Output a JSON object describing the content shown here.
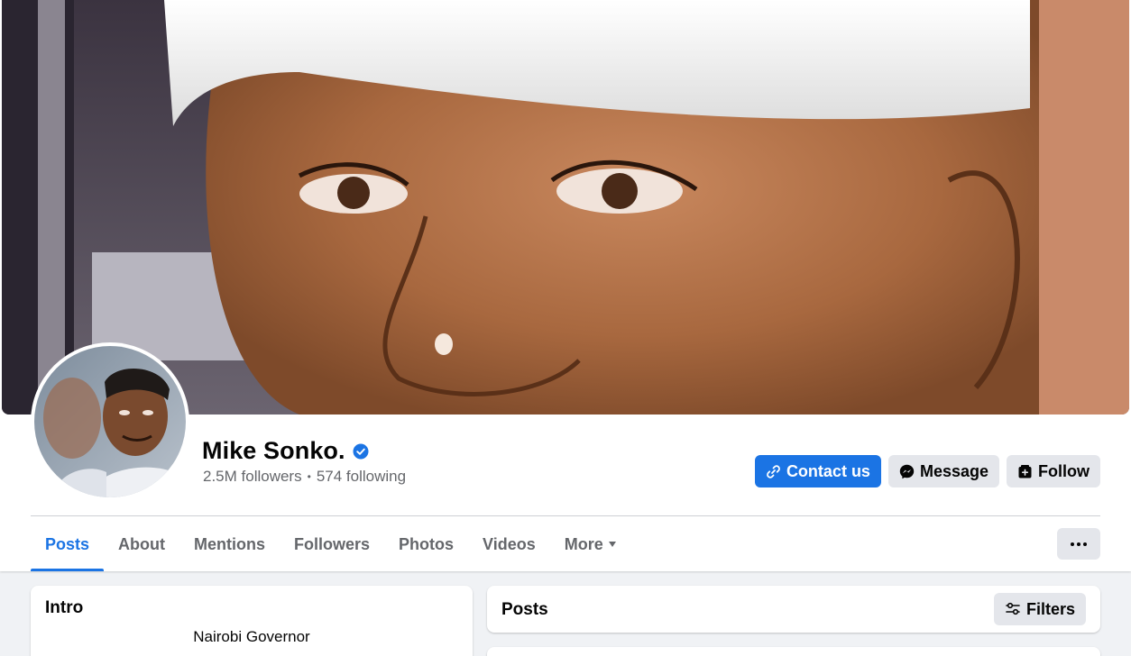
{
  "profile": {
    "name": "Mike Sonko.",
    "followers": "2.5M followers",
    "separator": "•",
    "following": "574 following",
    "verified_icon": "verified-badge-icon"
  },
  "actions": {
    "contact_label": "Contact us",
    "message_label": "Message",
    "follow_label": "Follow"
  },
  "tabs": [
    {
      "label": "Posts",
      "active": true
    },
    {
      "label": "About"
    },
    {
      "label": "Mentions"
    },
    {
      "label": "Followers"
    },
    {
      "label": "Photos"
    },
    {
      "label": "Videos"
    },
    {
      "label": "More"
    }
  ],
  "intro": {
    "title": "Intro",
    "bio": "Nairobi Governor"
  },
  "posts": {
    "title": "Posts",
    "filters_label": "Filters"
  },
  "colors": {
    "accent": "#1b74e4",
    "secondary_button": "#e4e6eb",
    "background": "#f0f2f5",
    "muted_text": "#65676b"
  }
}
